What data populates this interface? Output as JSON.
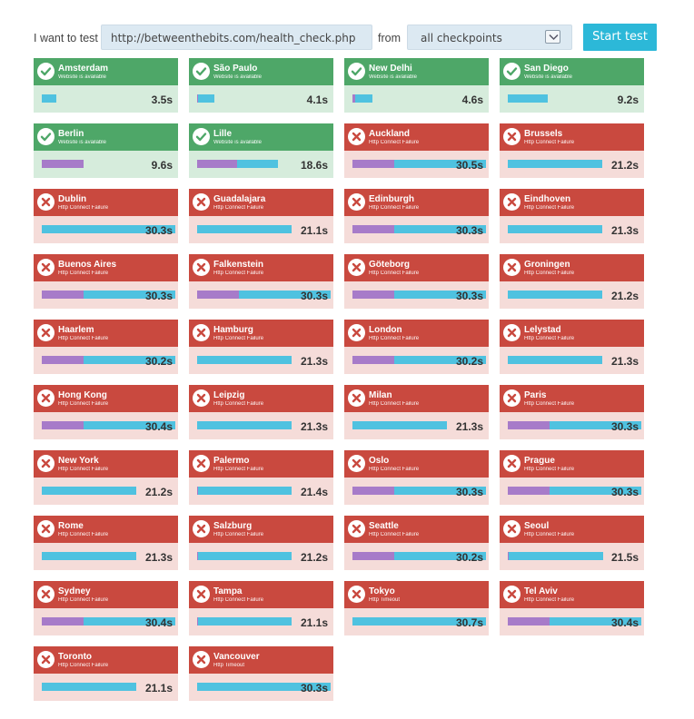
{
  "toolbar": {
    "want_label": "I want to test",
    "url_value": "http://betweenthebits.com/health_check.php",
    "from_label": "from",
    "checkpoints_value": "all checkpoints",
    "start_label": "Start test"
  },
  "colors": {
    "ok": "#4ea768",
    "fail": "#c9493f",
    "bar": "#4fc2e0",
    "segment": "#a77bc9",
    "button": "#2cb8d8"
  },
  "checkpoints": [
    {
      "city": "Amsterdam",
      "status": "Website is available",
      "ok": true,
      "time": "3.5s",
      "total": 0.11,
      "seg": 0.0
    },
    {
      "city": "São Paulo",
      "status": "Website is available",
      "ok": true,
      "time": "4.1s",
      "total": 0.13,
      "seg": 0.01
    },
    {
      "city": "New Delhi",
      "status": "Website is available",
      "ok": true,
      "time": "4.6s",
      "total": 0.15,
      "seg": 0.02
    },
    {
      "city": "San Diego",
      "status": "Website is available",
      "ok": true,
      "time": "9.2s",
      "total": 0.3,
      "seg": 0.0
    },
    {
      "city": "Berlin",
      "status": "Website is available",
      "ok": true,
      "time": "9.6s",
      "total": 0.31,
      "seg": 0.31
    },
    {
      "city": "Lille",
      "status": "Website is available",
      "ok": true,
      "time": "18.6s",
      "total": 0.6,
      "seg": 0.3
    },
    {
      "city": "Auckland",
      "status": "Http Connect Failure",
      "ok": false,
      "time": "30.5s",
      "total": 0.99,
      "seg": 0.31
    },
    {
      "city": "Brussels",
      "status": "Http Connect Failure",
      "ok": false,
      "time": "21.2s",
      "total": 0.7,
      "seg": 0.0
    },
    {
      "city": "Dublin",
      "status": "Http Connect Failure",
      "ok": false,
      "time": "30.3s",
      "total": 0.99,
      "seg": 0.0
    },
    {
      "city": "Guadalajara",
      "status": "Http Connect Failure",
      "ok": false,
      "time": "21.1s",
      "total": 0.7,
      "seg": 0.0
    },
    {
      "city": "Edinburgh",
      "status": "Http Connect Failure",
      "ok": false,
      "time": "30.3s",
      "total": 0.99,
      "seg": 0.31
    },
    {
      "city": "Eindhoven",
      "status": "Http Connect Failure",
      "ok": false,
      "time": "21.3s",
      "total": 0.7,
      "seg": 0.0
    },
    {
      "city": "Buenos Aires",
      "status": "Http Connect Failure",
      "ok": false,
      "time": "30.3s",
      "total": 0.99,
      "seg": 0.31
    },
    {
      "city": "Falkenstein",
      "status": "Http Connect Failure",
      "ok": false,
      "time": "30.3s",
      "total": 0.99,
      "seg": 0.31
    },
    {
      "city": "Göteborg",
      "status": "Http Connect Failure",
      "ok": false,
      "time": "30.3s",
      "total": 0.99,
      "seg": 0.31
    },
    {
      "city": "Groningen",
      "status": "Http Connect Failure",
      "ok": false,
      "time": "21.2s",
      "total": 0.7,
      "seg": 0.0
    },
    {
      "city": "Haarlem",
      "status": "Http Connect Failure",
      "ok": false,
      "time": "30.2s",
      "total": 0.99,
      "seg": 0.31
    },
    {
      "city": "Hamburg",
      "status": "Http Connect Failure",
      "ok": false,
      "time": "21.3s",
      "total": 0.7,
      "seg": 0.0
    },
    {
      "city": "London",
      "status": "Http Connect Failure",
      "ok": false,
      "time": "30.2s",
      "total": 0.99,
      "seg": 0.31
    },
    {
      "city": "Lelystad",
      "status": "Http Connect Failure",
      "ok": false,
      "time": "21.3s",
      "total": 0.7,
      "seg": 0.0
    },
    {
      "city": "Hong Kong",
      "status": "Http Connect Failure",
      "ok": false,
      "time": "30.4s",
      "total": 0.99,
      "seg": 0.31
    },
    {
      "city": "Leipzig",
      "status": "Http Connect Failure",
      "ok": false,
      "time": "21.3s",
      "total": 0.7,
      "seg": 0.0
    },
    {
      "city": "Milan",
      "status": "Http Connect Failure",
      "ok": false,
      "time": "21.3s",
      "total": 0.7,
      "seg": 0.0
    },
    {
      "city": "Paris",
      "status": "Http Connect Failure",
      "ok": false,
      "time": "30.3s",
      "total": 0.99,
      "seg": 0.31
    },
    {
      "city": "New York",
      "status": "Http Connect Failure",
      "ok": false,
      "time": "21.2s",
      "total": 0.7,
      "seg": 0.0
    },
    {
      "city": "Palermo",
      "status": "Http Connect Failure",
      "ok": false,
      "time": "21.4s",
      "total": 0.7,
      "seg": 0.01
    },
    {
      "city": "Oslo",
      "status": "Http Connect Failure",
      "ok": false,
      "time": "30.3s",
      "total": 0.99,
      "seg": 0.31
    },
    {
      "city": "Prague",
      "status": "Http Connect Failure",
      "ok": false,
      "time": "30.3s",
      "total": 0.99,
      "seg": 0.31
    },
    {
      "city": "Rome",
      "status": "Http Connect Failure",
      "ok": false,
      "time": "21.3s",
      "total": 0.7,
      "seg": 0.0
    },
    {
      "city": "Salzburg",
      "status": "Http Connect Failure",
      "ok": false,
      "time": "21.2s",
      "total": 0.7,
      "seg": 0.01
    },
    {
      "city": "Seattle",
      "status": "Http Connect Failure",
      "ok": false,
      "time": "30.2s",
      "total": 0.99,
      "seg": 0.31
    },
    {
      "city": "Seoul",
      "status": "Http Connect Failure",
      "ok": false,
      "time": "21.5s",
      "total": 0.71,
      "seg": 0.01
    },
    {
      "city": "Sydney",
      "status": "Http Connect Failure",
      "ok": false,
      "time": "30.4s",
      "total": 0.99,
      "seg": 0.31
    },
    {
      "city": "Tampa",
      "status": "Http Connect Failure",
      "ok": false,
      "time": "21.1s",
      "total": 0.7,
      "seg": 0.01
    },
    {
      "city": "Tokyo",
      "status": "Http Timeout",
      "ok": false,
      "time": "30.7s",
      "total": 0.99,
      "seg": 0.0
    },
    {
      "city": "Tel Aviv",
      "status": "Http Connect Failure",
      "ok": false,
      "time": "30.4s",
      "total": 0.99,
      "seg": 0.31
    },
    {
      "city": "Toronto",
      "status": "Http Connect Failure",
      "ok": false,
      "time": "21.1s",
      "total": 0.7,
      "seg": 0.0
    },
    {
      "city": "Vancouver",
      "status": "Http Timeout",
      "ok": false,
      "time": "30.3s",
      "total": 0.99,
      "seg": 0.0
    }
  ]
}
